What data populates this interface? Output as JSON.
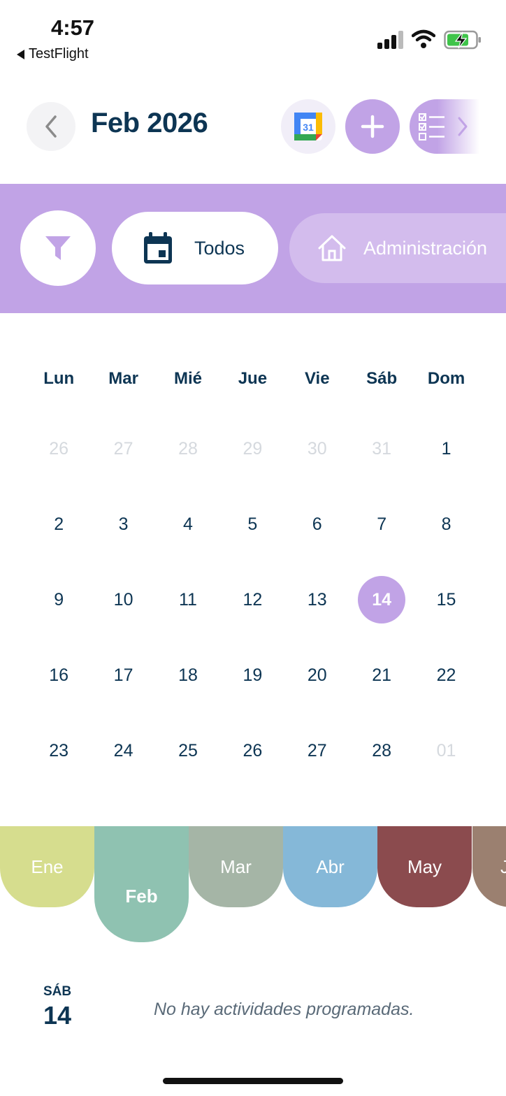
{
  "status_bar": {
    "time": "4:57",
    "back_app": "TestFlight"
  },
  "header": {
    "month_title": "Feb 2026",
    "google_calendar_badge": "31"
  },
  "filters": {
    "chips": [
      {
        "label": "Todos",
        "icon": "calendar-icon"
      },
      {
        "label": "Administración",
        "icon": "home-icon"
      }
    ]
  },
  "calendar": {
    "weekdays": [
      "Lun",
      "Mar",
      "Mié",
      "Jue",
      "Vie",
      "Sáb",
      "Dom"
    ],
    "weeks": [
      [
        "26",
        "27",
        "28",
        "29",
        "30",
        "31",
        "1"
      ],
      [
        "2",
        "3",
        "4",
        "5",
        "6",
        "7",
        "8"
      ],
      [
        "9",
        "10",
        "11",
        "12",
        "13",
        "14",
        "15"
      ],
      [
        "16",
        "17",
        "18",
        "19",
        "20",
        "21",
        "22"
      ],
      [
        "23",
        "24",
        "25",
        "26",
        "27",
        "28",
        "01"
      ]
    ],
    "selected_day": "14",
    "selected_color": "#c1a3e6"
  },
  "month_tabs": [
    {
      "label": "Ene",
      "color": "#d6dd8e"
    },
    {
      "label": "Feb",
      "color": "#8fc2b1",
      "active": true
    },
    {
      "label": "Mar",
      "color": "#a5b5a6"
    },
    {
      "label": "Abr",
      "color": "#85b8d8"
    },
    {
      "label": "May",
      "color": "#8b4b4e"
    },
    {
      "label": "J",
      "color": "#9b8070"
    }
  ],
  "agenda": {
    "day_of_week": "SÁB",
    "day_number": "14",
    "empty_message": "No hay actividades programadas."
  },
  "colors": {
    "primary_text": "#0d3553",
    "accent": "#c1a3e6"
  }
}
